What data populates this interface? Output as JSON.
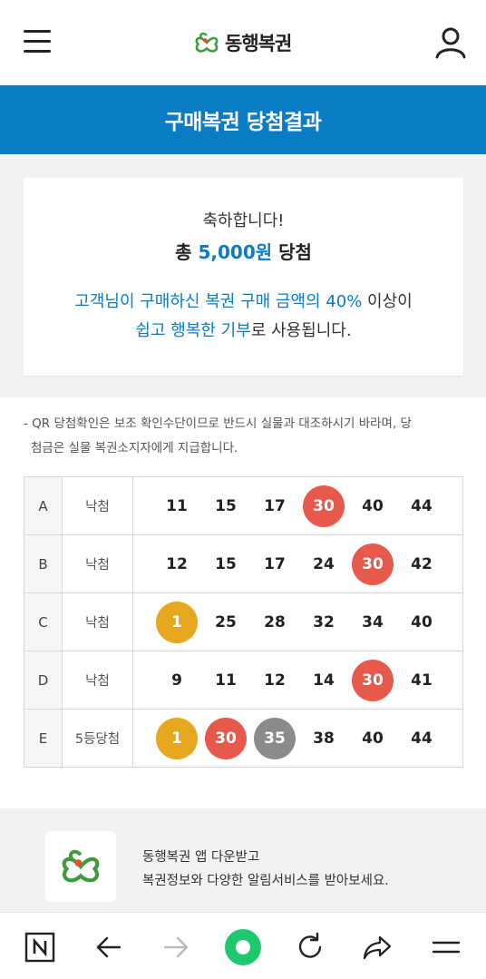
{
  "header": {
    "logo_text": "동행복권"
  },
  "title_bar": {
    "title": "구매복권 당첨결과"
  },
  "card": {
    "congrats": "축하합니다!",
    "total_prefix": "총 ",
    "total_amount": "5,000원",
    "total_suffix": " 당첨",
    "msg1_blue": "고객님이 구매하신 복권 구매 금액의 40%",
    "msg1_dark": " 이상이",
    "msg2_blue": "쉽고 행복한 기부",
    "msg2_dark": "로 사용됩니다."
  },
  "notice": {
    "line1": "- QR 당첨확인은 보조 확인수단이므로 반드시 실물과 대조하시기 바라며, 당",
    "line2": "첨금은 실물 복권소지자에게 지급합니다."
  },
  "results": [
    {
      "letter": "A",
      "status": "낙첨",
      "numbers": [
        "11",
        "15",
        "17",
        "30",
        "40",
        "44"
      ],
      "hits": [
        3
      ],
      "hit_colors": [
        "#e8594d"
      ]
    },
    {
      "letter": "B",
      "status": "낙첨",
      "numbers": [
        "12",
        "15",
        "17",
        "24",
        "30",
        "42"
      ],
      "hits": [
        4
      ],
      "hit_colors": [
        "#e8594d"
      ]
    },
    {
      "letter": "C",
      "status": "낙첨",
      "numbers": [
        "1",
        "25",
        "28",
        "32",
        "34",
        "40"
      ],
      "hits": [
        0
      ],
      "hit_colors": [
        "#e5a81e"
      ]
    },
    {
      "letter": "D",
      "status": "낙첨",
      "numbers": [
        "9",
        "11",
        "12",
        "14",
        "30",
        "41"
      ],
      "hits": [
        4
      ],
      "hit_colors": [
        "#e8594d"
      ]
    },
    {
      "letter": "E",
      "status": "5등당첨",
      "numbers": [
        "1",
        "30",
        "35",
        "38",
        "40",
        "44"
      ],
      "hits": [
        0,
        1,
        2
      ],
      "hit_colors": [
        "#e5a81e",
        "#e8594d",
        "#8b8b8b"
      ]
    }
  ],
  "banner": {
    "line1": "동행복권 앱 다운받고",
    "line2": "복권정보와 다양한 알림서비스를 받아보세요."
  },
  "colors": {
    "brand_blue": "#0a7cc6",
    "logo_green": "#3f9a3b",
    "nav_green": "#1ec86e"
  },
  "icons": {
    "menu": "hamburger-icon",
    "user": "user-icon",
    "tabs": "naver-n-icon",
    "back": "arrow-left-icon",
    "forward": "arrow-right-icon",
    "home": "green-circle-icon",
    "refresh": "refresh-icon",
    "share": "share-icon",
    "more": "more-menu-icon"
  }
}
